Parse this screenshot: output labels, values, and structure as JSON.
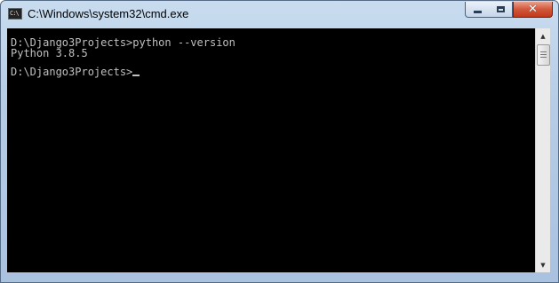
{
  "window": {
    "title": "C:\\Windows\\system32\\cmd.exe",
    "icon_label": "C:\\",
    "icon": "cmd-icon",
    "minimize_icon": "minimize-icon",
    "maximize_icon": "maximize-icon",
    "close_icon": "close-icon",
    "close_glyph": "✕"
  },
  "console": {
    "line1": "D:\\Django3Projects>python --version",
    "line2": "Python 3.8.5",
    "line3": "D:\\Django3Projects>"
  },
  "scrollbar": {
    "up_glyph": "▲",
    "down_glyph": "▼"
  },
  "colors": {
    "console_bg": "#000000",
    "console_text": "#c0c0c0",
    "close_button": "#c8401f",
    "frame": "#b7cde6"
  }
}
